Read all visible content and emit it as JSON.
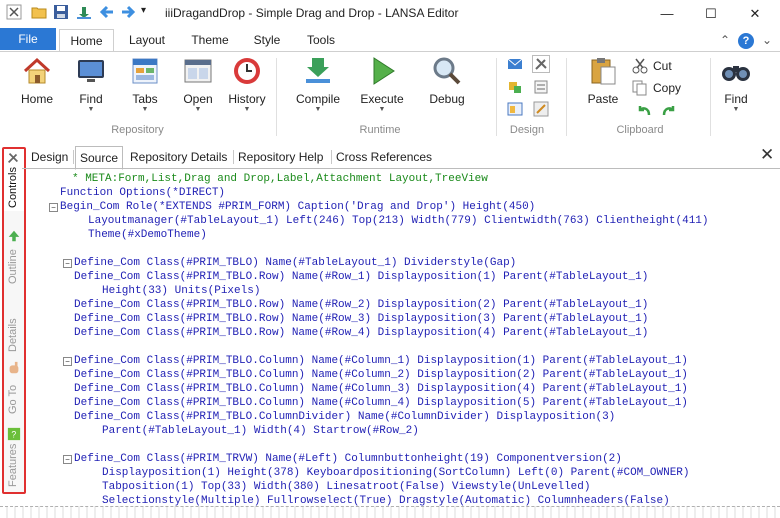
{
  "window": {
    "title": "iiiDragandDrop - Simple Drag and Drop - LANSA Editor",
    "minimize_glyph": "—",
    "maximize_glyph": "☐",
    "close_glyph": "✕"
  },
  "quick_access": {
    "icons": [
      "lansa-logo-icon",
      "open-folder-icon",
      "save-icon",
      "download-icon",
      "back-arrow-icon",
      "forward-arrow-icon",
      "dropdown-arrow-icon"
    ],
    "more_glyph": "▾"
  },
  "menu": {
    "file": "File",
    "tabs": [
      "Home",
      "Layout",
      "Theme",
      "Style",
      "Tools"
    ],
    "collapse_glyph": "⌃",
    "help_glyph": "?",
    "options_glyph": "⌄"
  },
  "ribbon": {
    "home": "Home",
    "find": "Find",
    "tabs": "Tabs",
    "open": "Open",
    "history": "History",
    "repository_group": "Repository",
    "compile": "Compile",
    "execute": "Execute",
    "debug": "Debug",
    "runtime_group": "Runtime",
    "design_group": "Design",
    "paste": "Paste",
    "cut": "Cut",
    "copy": "Copy",
    "clipboard_group": "Clipboard",
    "find_big": "Find",
    "dropdown_arrow": "▼"
  },
  "sidebar": {
    "controls": "Controls",
    "outline": "Outline",
    "details": "Details",
    "goto": "Go To",
    "features": "Features"
  },
  "doc_tabs": {
    "tabs": [
      "Design",
      "Source",
      "Repository Details",
      "Repository Help",
      "Cross References"
    ],
    "active": "Source",
    "close_glyph": "✕"
  },
  "code_lines": [
    "* META:Form,List,Drag and Drop,Label,Attachment Layout,TreeView",
    "Function Options(*DIRECT)",
    "Begin_Com Role(*EXTENDS #PRIM_FORM) Caption('Drag and Drop') Height(450)",
    "Layoutmanager(#TableLayout_1) Left(246) Top(213) Width(779) Clientwidth(763) Clientheight(411)",
    "Theme(#xDemoTheme)",
    "Define_Com Class(#PRIM_TBLO) Name(#TableLayout_1) Dividerstyle(Gap)",
    "Define_Com Class(#PRIM_TBLO.Row) Name(#Row_1) Displayposition(1) Parent(#TableLayout_1)",
    "Height(33) Units(Pixels)",
    "Define_Com Class(#PRIM_TBLO.Row) Name(#Row_2) Displayposition(2) Parent(#TableLayout_1)",
    "Define_Com Class(#PRIM_TBLO.Row) Name(#Row_3) Displayposition(3) Parent(#TableLayout_1)",
    "Define_Com Class(#PRIM_TBLO.Row) Name(#Row_4) Displayposition(4) Parent(#TableLayout_1)",
    "Define_Com Class(#PRIM_TBLO.Column) Name(#Column_1) Displayposition(1) Parent(#TableLayout_1)",
    "Define_Com Class(#PRIM_TBLO.Column) Name(#Column_2) Displayposition(2) Parent(#TableLayout_1)",
    "Define_Com Class(#PRIM_TBLO.Column) Name(#Column_3) Displayposition(4) Parent(#TableLayout_1)",
    "Define_Com Class(#PRIM_TBLO.Column) Name(#Column_4) Displayposition(5) Parent(#TableLayout_1)",
    "Define_Com Class(#PRIM_TBLO.ColumnDivider) Name(#ColumnDivider) Displayposition(3)",
    "Parent(#TableLayout_1) Width(4) Startrow(#Row_2)",
    "Define_Com Class(#PRIM_TRVW) Name(#Left) Columnbuttonheight(19) Componentversion(2)",
    "Displayposition(1) Height(378) Keyboardpositioning(SortColumn) Left(0) Parent(#COM_OWNER)",
    "Tabposition(1) Top(33) Width(380) Linesatroot(False) Viewstyle(UnLevelled)",
    "Selectionstyle(Multiple) Fullrowselect(True) Dragstyle(Automatic) Columnheaders(False)"
  ],
  "fold_glyph": "⊟",
  "colors": {
    "accent": "#2b78d4",
    "code_blue": "#1f1fb4",
    "code_green": "#1a8a1a",
    "highlight_border": "#e03030"
  }
}
